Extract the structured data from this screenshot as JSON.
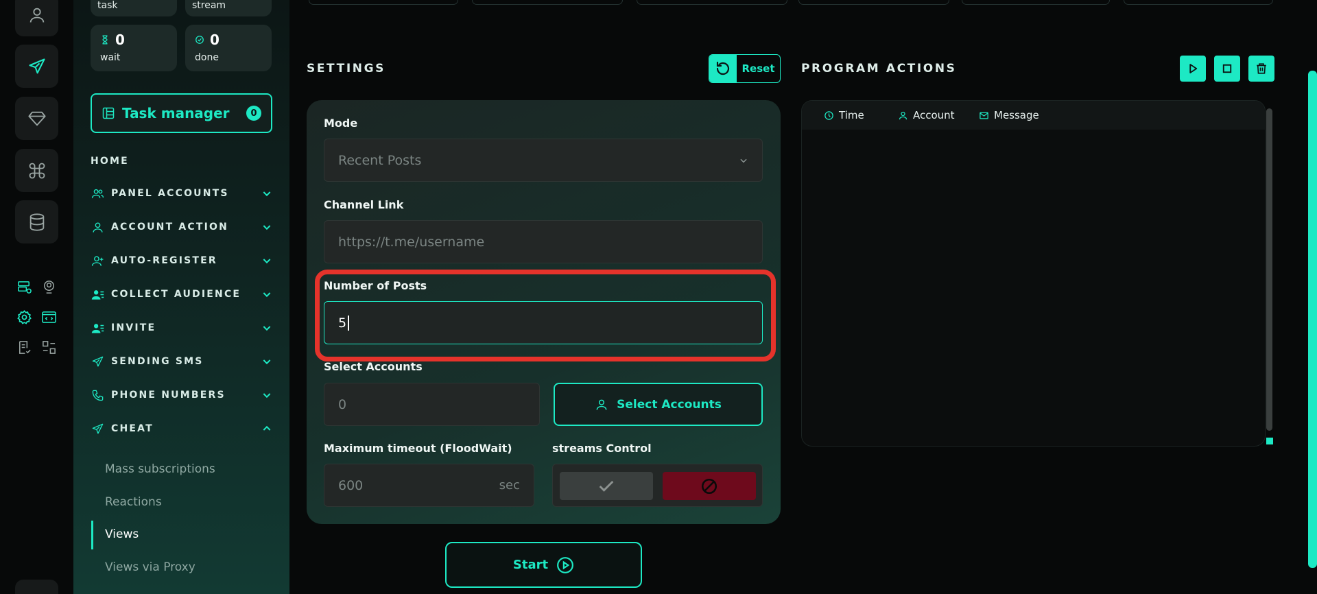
{
  "stats": {
    "task_label": "task",
    "stream_label": "stream",
    "wait_value": "0",
    "wait_label": "wait",
    "done_value": "0",
    "done_label": "done"
  },
  "task_manager": {
    "label": "Task manager",
    "count": "0"
  },
  "nav": {
    "home": "HOME",
    "items": [
      {
        "label": "PANEL ACCOUNTS",
        "icon": "users-icon"
      },
      {
        "label": "ACCOUNT ACTION",
        "icon": "user-icon"
      },
      {
        "label": "AUTO-REGISTER",
        "icon": "user-plus-icon"
      },
      {
        "label": "COLLECT AUDIENCE",
        "icon": "user-list-icon"
      },
      {
        "label": "INVITE",
        "icon": "user-list-icon"
      },
      {
        "label": "SENDING SMS",
        "icon": "send-icon"
      },
      {
        "label": "PHONE NUMBERS",
        "icon": "phone-icon"
      },
      {
        "label": "CHEAT",
        "icon": "send-icon"
      }
    ],
    "cheat_sub": [
      "Mass subscriptions",
      "Reactions",
      "Views",
      "Views via Proxy"
    ],
    "active_sub": "Views"
  },
  "settings": {
    "title": "SETTINGS",
    "reset_label": "Reset",
    "mode_label": "Mode",
    "mode_value": "Recent Posts",
    "channel_label": "Channel Link",
    "channel_placeholder": "https://t.me/username",
    "posts_label": "Number of Posts",
    "posts_value": "5",
    "accounts_label": "Select Accounts",
    "accounts_value": "0",
    "select_accounts_button": "Select Accounts",
    "timeout_label": "Maximum timeout (FloodWait)",
    "timeout_placeholder": "600",
    "timeout_unit": "sec",
    "streams_label": "streams Control",
    "start_label": "Start"
  },
  "program_actions": {
    "title": "PROGRAM ACTIONS",
    "columns": [
      "Time",
      "Account",
      "Message"
    ]
  },
  "colors": {
    "accent": "#1de9c4",
    "danger": "#6e0a1c",
    "highlight": "#e5332b"
  }
}
